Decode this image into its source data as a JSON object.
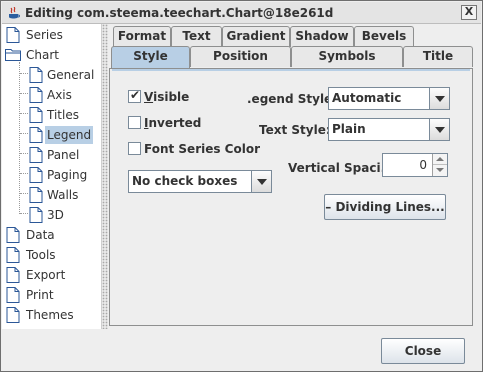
{
  "window": {
    "title": "Editing com.steema.teechart.Chart@18e261d",
    "close_label": "X"
  },
  "tree": {
    "items": [
      {
        "label": "Series",
        "kind": "doc"
      },
      {
        "label": "Chart",
        "kind": "folder"
      },
      {
        "label": "General",
        "kind": "doc"
      },
      {
        "label": "Axis",
        "kind": "doc"
      },
      {
        "label": "Titles",
        "kind": "doc"
      },
      {
        "label": "Legend",
        "kind": "doc",
        "selected": true
      },
      {
        "label": "Panel",
        "kind": "doc"
      },
      {
        "label": "Paging",
        "kind": "doc"
      },
      {
        "label": "Walls",
        "kind": "doc"
      },
      {
        "label": "3D",
        "kind": "doc"
      },
      {
        "label": "Data",
        "kind": "doc"
      },
      {
        "label": "Tools",
        "kind": "doc"
      },
      {
        "label": "Export",
        "kind": "doc"
      },
      {
        "label": "Print",
        "kind": "doc"
      },
      {
        "label": "Themes",
        "kind": "doc"
      }
    ]
  },
  "tabs_row1": [
    "Format",
    "Text",
    "Gradient",
    "Shadow",
    "Bevels"
  ],
  "tabs_row2": [
    "Style",
    "Position",
    "Symbols",
    "Title"
  ],
  "active_tab": "Style",
  "style": {
    "visible": {
      "label": "Visible",
      "checked": true
    },
    "inverted": {
      "label": "Inverted",
      "checked": false
    },
    "font_series_color": {
      "label": "Font Series Color",
      "checked": false
    },
    "check_boxes_select": "No check boxes",
    "legend_style_label": ".egend Style:",
    "legend_style_value": "Automatic",
    "text_style_label": "Text Style:",
    "text_style_value": "Plain",
    "vertical_spacing_label": "Vertical Spaci...",
    "vertical_spacing_value": "0",
    "dividing_lines_label": "Dividing Lines...",
    "dividing_lines_prefix": "–"
  },
  "footer": {
    "close_label": "Close"
  },
  "colors": {
    "accent": "#b8cfe5",
    "selected_tree": "#b8cfe5"
  }
}
